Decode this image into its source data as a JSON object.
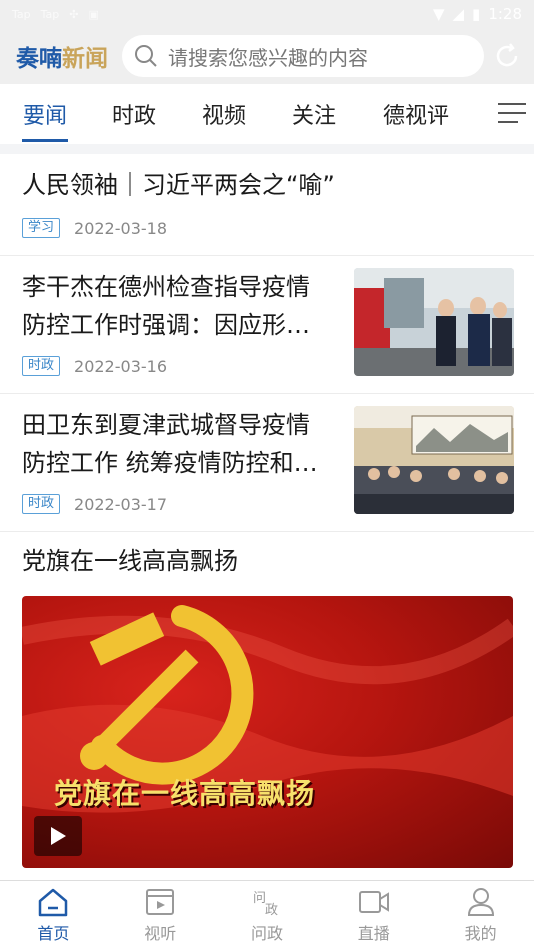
{
  "status": {
    "left": [
      "Tap",
      "Tap"
    ],
    "time": "1:28"
  },
  "header": {
    "logo_a": "奏喃",
    "logo_b": "新闻",
    "search_placeholder": "请搜索您感兴趣的内容"
  },
  "tabs": [
    {
      "label": "要闻",
      "active": true
    },
    {
      "label": "时政"
    },
    {
      "label": "视频"
    },
    {
      "label": "关注"
    },
    {
      "label": "德视评"
    }
  ],
  "news": [
    {
      "title": "人民领袖｜习近平两会之“喻”",
      "tag": "学习",
      "date": "2022-03-18"
    },
    {
      "title_line1": "李干杰在德州检查指导疫情",
      "title_line2": "防控工作时强调：因应形…",
      "tag": "时政",
      "date": "2022-03-16"
    },
    {
      "title_line1": "田卫东到夏津武城督导疫情",
      "title_line2": "防控工作 统筹疫情防控和…",
      "tag": "时政",
      "date": "2022-03-17"
    },
    {
      "title": "党旗在一线高高飘扬",
      "video_caption": "党旗在一线高高飘扬"
    }
  ],
  "bottom_nav": [
    {
      "label": "首页",
      "icon": "home-icon",
      "active": true
    },
    {
      "label": "视听",
      "icon": "video-icon"
    },
    {
      "label": "问政",
      "icon": "wenzheng-icon"
    },
    {
      "label": "直播",
      "icon": "camera-icon"
    },
    {
      "label": "我的",
      "icon": "user-icon"
    }
  ],
  "colors": {
    "accent": "#1f5aa8",
    "tag": "#3a86c8"
  }
}
